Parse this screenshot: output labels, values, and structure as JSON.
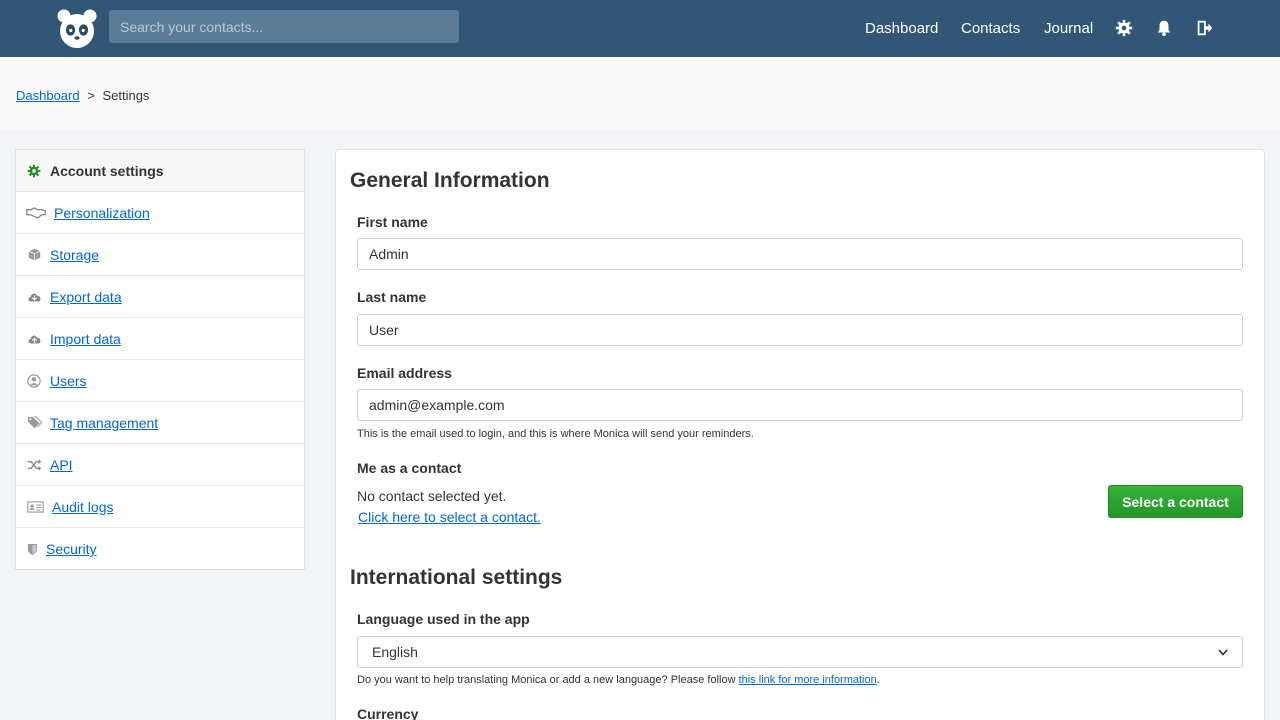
{
  "nav": {
    "search_placeholder": "Search your contacts...",
    "links": [
      "Dashboard",
      "Contacts",
      "Journal"
    ],
    "icons": [
      "gear-icon",
      "bell-icon",
      "logout-icon"
    ]
  },
  "breadcrumb": {
    "home": "Dashboard",
    "separator": ">",
    "current": "Settings"
  },
  "sidebar": {
    "items": [
      {
        "label": "Account settings",
        "icon": "gear-icon",
        "active": true
      },
      {
        "label": "Personalization",
        "icon": "handshake-icon"
      },
      {
        "label": "Storage",
        "icon": "box-icon"
      },
      {
        "label": "Export data",
        "icon": "cloud-download-icon"
      },
      {
        "label": "Import data",
        "icon": "cloud-upload-icon"
      },
      {
        "label": "Users",
        "icon": "user-circle-icon"
      },
      {
        "label": "Tag management",
        "icon": "tags-icon"
      },
      {
        "label": "API",
        "icon": "random-icon"
      },
      {
        "label": "Audit logs",
        "icon": "id-card-icon"
      },
      {
        "label": "Security",
        "icon": "shield-icon"
      }
    ]
  },
  "general": {
    "title": "General Information",
    "first_name_label": "First name",
    "first_name_value": "Admin",
    "last_name_label": "Last name",
    "last_name_value": "User",
    "email_label": "Email address",
    "email_value": "admin@example.com",
    "email_help": "This is the email used to login, and this is where Monica will send your reminders.",
    "me_contact_label": "Me as a contact",
    "no_contact_text": "No contact selected yet.",
    "select_link": "Click here to select a contact.",
    "select_button": "Select a contact"
  },
  "international": {
    "title": "International settings",
    "language_label": "Language used in the app",
    "language_value": "English",
    "language_help_prefix": "Do you want to help translating Monica or add a new language? Please follow ",
    "language_help_link": "this link for more information",
    "language_help_suffix": ".",
    "currency_label": "Currency"
  },
  "colors": {
    "nav_bg": "#325776",
    "link": "#0366d6",
    "button_green": "#2ca02c",
    "sidebar_active_icon": "#2a8a2a"
  }
}
